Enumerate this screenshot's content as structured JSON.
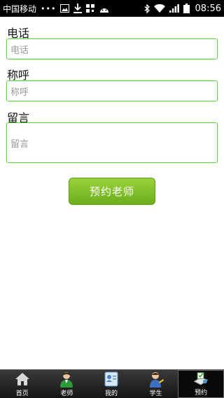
{
  "status_bar": {
    "carrier": "中国移动",
    "dots": "•••",
    "time": "08:56"
  },
  "form": {
    "phone": {
      "label": "电话",
      "placeholder": "电话"
    },
    "salutation": {
      "label": "称呼",
      "placeholder": "称呼"
    },
    "message": {
      "label": "留言",
      "placeholder": "留言"
    },
    "submit_label": "预约老师"
  },
  "tabs": [
    {
      "label": "首页",
      "icon": "home-icon",
      "active": false
    },
    {
      "label": "老师",
      "icon": "teacher-icon",
      "active": false
    },
    {
      "label": "我的",
      "icon": "profile-card-icon",
      "active": false
    },
    {
      "label": "学生",
      "icon": "student-icon",
      "active": false
    },
    {
      "label": "预约",
      "icon": "appointment-icon",
      "active": true
    }
  ],
  "colors": {
    "input_border": "#55d93a",
    "button_top": "#98d23a",
    "button_bottom": "#6cae1c"
  }
}
